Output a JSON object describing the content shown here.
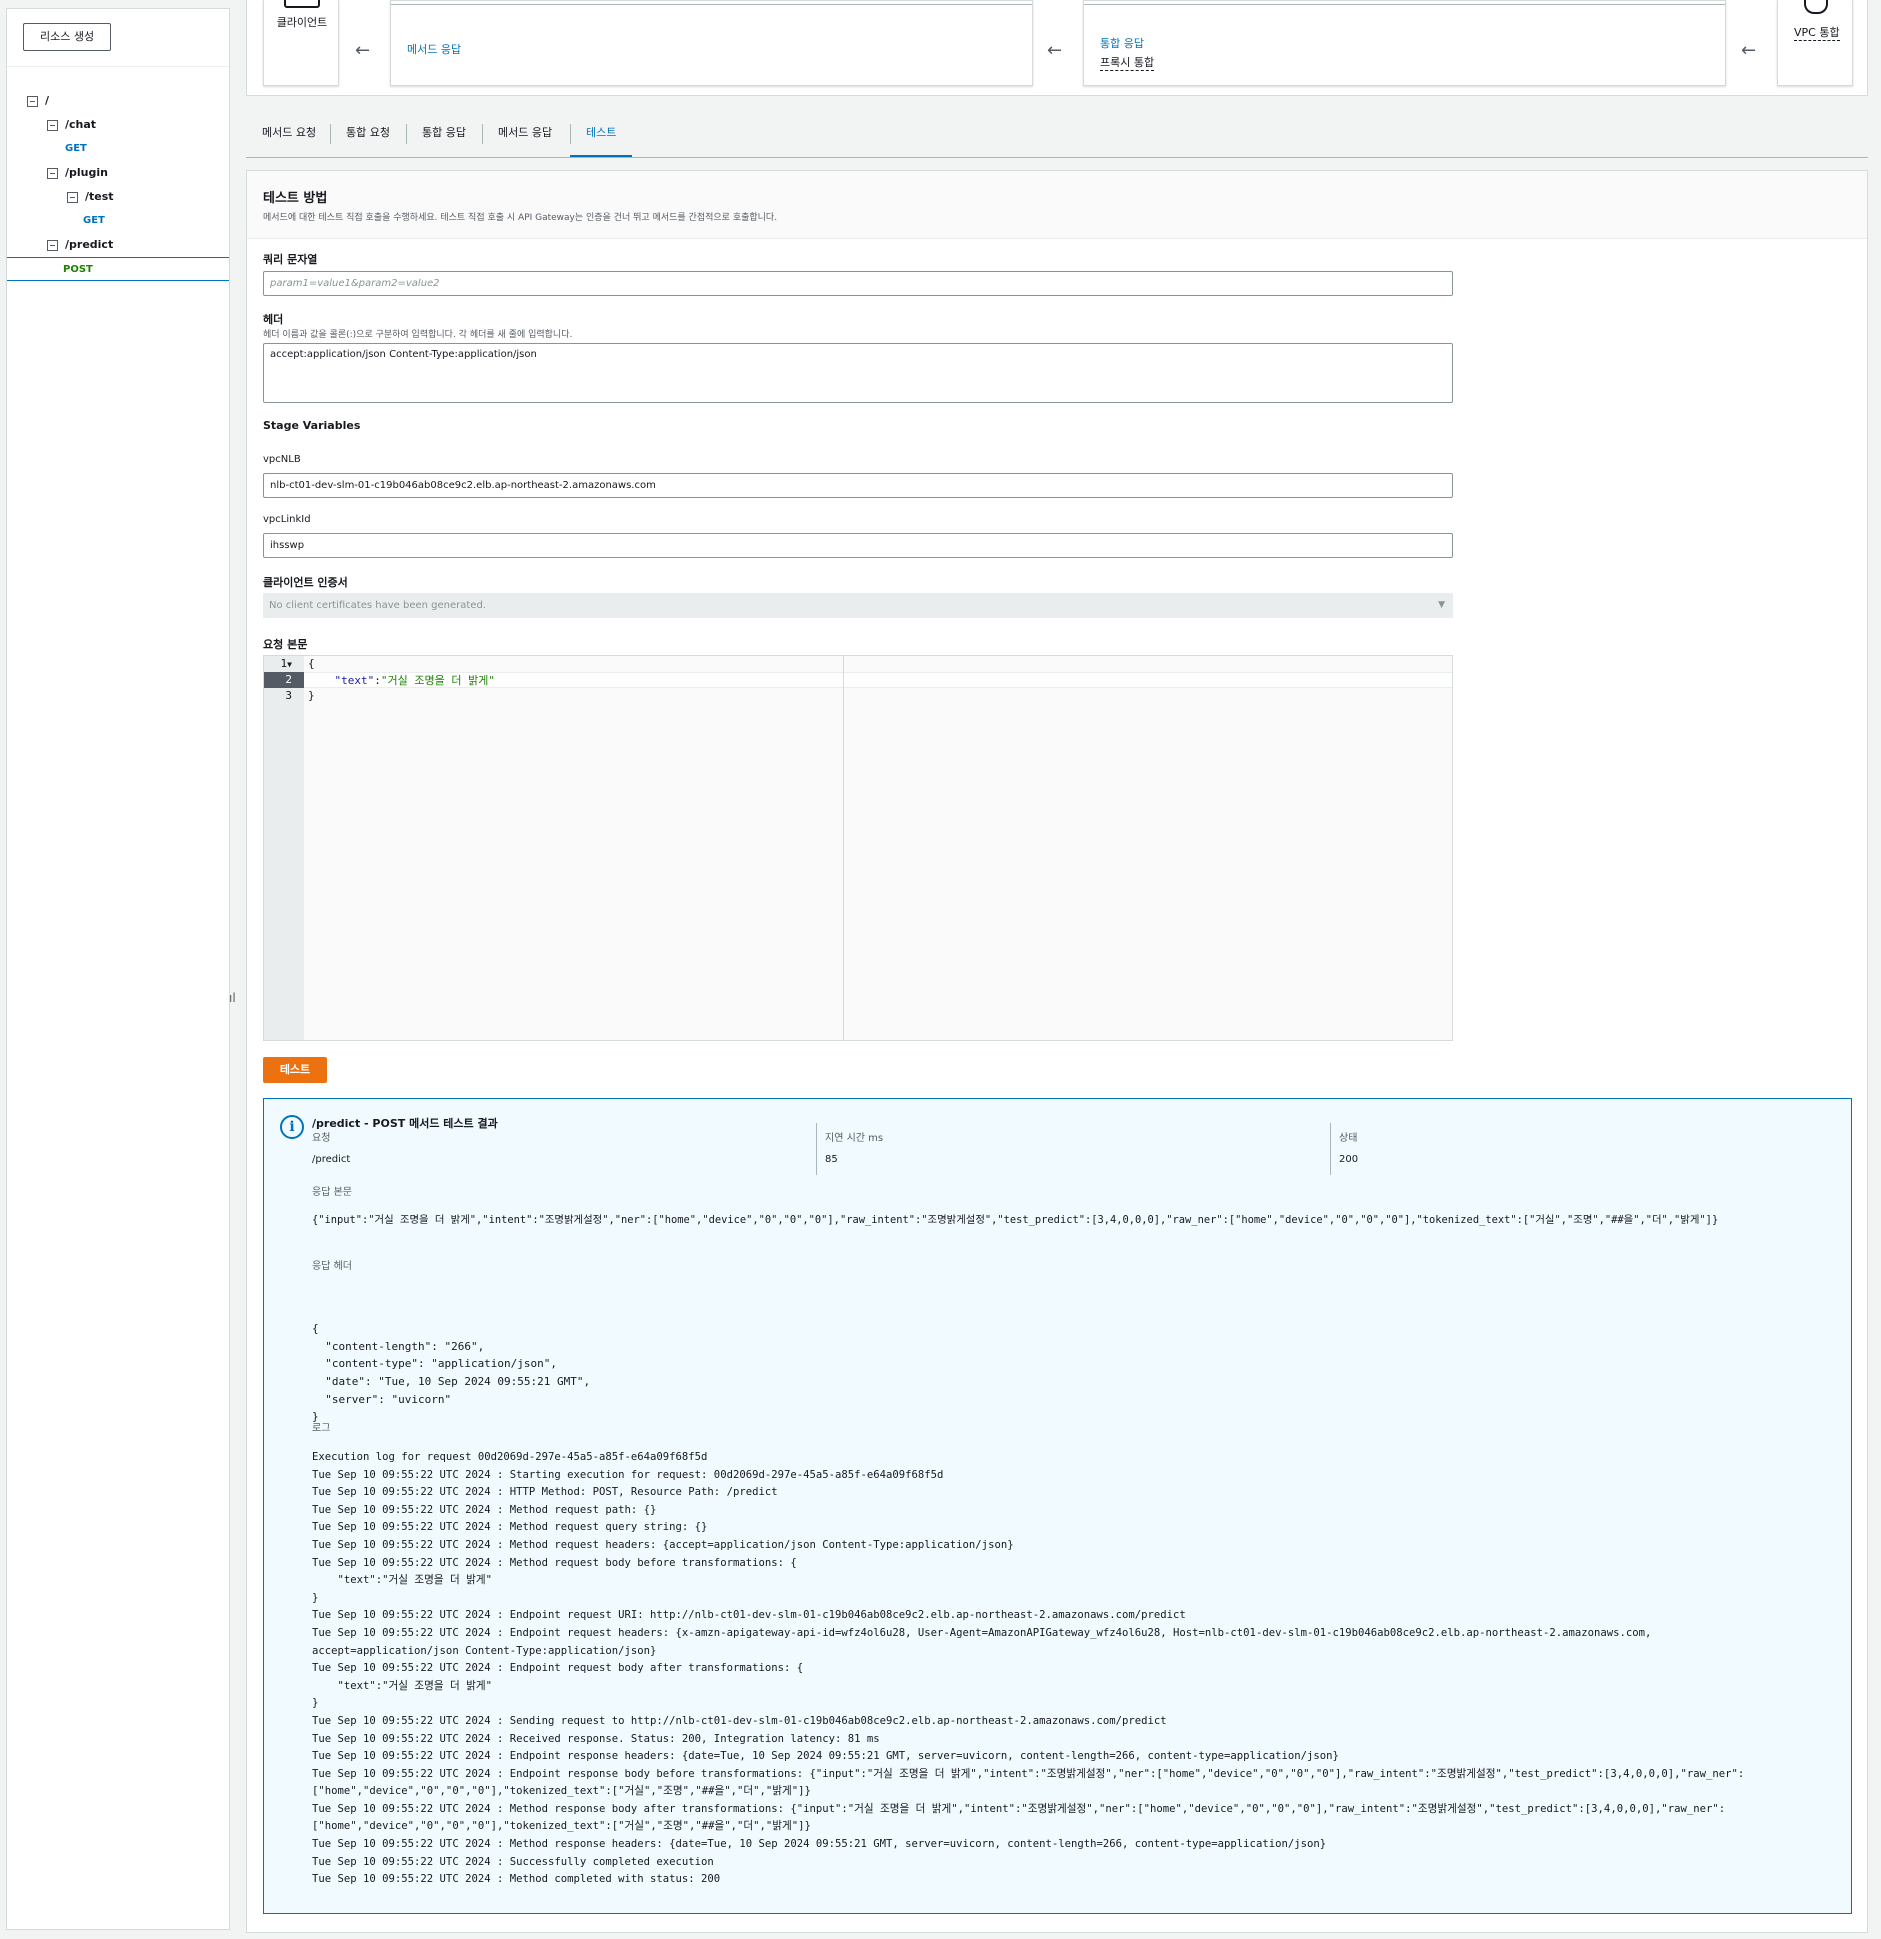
{
  "sidebar": {
    "create_button": "리소스 생성",
    "tree": [
      {
        "label": "/",
        "type": "path",
        "depth": 0
      },
      {
        "label": "/chat",
        "type": "path",
        "depth": 1
      },
      {
        "label": "GET",
        "type": "method",
        "depth": 2
      },
      {
        "label": "/plugin",
        "type": "path",
        "depth": 1
      },
      {
        "label": "/test",
        "type": "path",
        "depth": 2
      },
      {
        "label": "GET",
        "type": "method",
        "depth": 3
      },
      {
        "label": "/predict",
        "type": "path",
        "depth": 1
      },
      {
        "label": "POST",
        "type": "method",
        "depth": 2,
        "selected": true
      }
    ],
    "collapse_glyph": "ıl"
  },
  "flow": {
    "client": "클라이언트",
    "method_response": "메서드 응답",
    "integration_response": "통합 응답",
    "integration_response_sub": "프록시 통합",
    "vpc": "VPC 통합",
    "arrow": "←"
  },
  "tabs": [
    {
      "label": "메서드 요청",
      "active": false
    },
    {
      "label": "통합 요청",
      "active": false
    },
    {
      "label": "통합 응답",
      "active": false
    },
    {
      "label": "메서드 응답",
      "active": false
    },
    {
      "label": "테스트",
      "active": true
    }
  ],
  "test": {
    "title": "테스트 방법",
    "description": "메서드에 대한 테스트 직접 호출을 수행하세요. 테스트 직접 호출 시 API Gateway는 인증을 건너 뛰고 메서드를 간접적으로 호출합니다.",
    "query_label": "쿼리 문자열",
    "query_placeholder": "param1=value1&param2=value2",
    "headers_label": "헤더",
    "headers_hint": "헤더 이름과 값을 콜론(:)으로 구분하여 입력합니다. 각 헤더를 새 줄에 입력합니다.",
    "headers_value": "accept:application/json Content-Type:application/json",
    "stage_vars_label": "Stage Variables",
    "vpcnlb_label": "vpcNLB",
    "vpcnlb_value": "nlb-ct01-dev-slm-01-c19b046ab08ce9c2.elb.ap-northeast-2.amazonaws.com",
    "vpclinkid_label": "vpcLinkId",
    "vpclinkid_value": "ihsswp",
    "client_cert_label": "클라이언트 인증서",
    "client_cert_value": "No client certificates have been generated.",
    "body_label": "요청 본문",
    "body_lines": [
      "1",
      "2",
      "3"
    ],
    "body_open": "{",
    "body_key": "\"text\"",
    "body_colon": ":",
    "body_val": "\"거실 조명을 더 밝게\"",
    "body_close": "}",
    "test_button": "테스트"
  },
  "result": {
    "title": "/predict - POST 메서드 테스트 결과",
    "request_label": "요청",
    "request_value": "/predict",
    "latency_label": "지연 시간 ms",
    "latency_value": "85",
    "status_label": "상태",
    "status_value": "200",
    "response_body_label": "응답 본문",
    "response_body": "{\"input\":\"거실 조명을 더 밝게\",\"intent\":\"조명밝게설정\",\"ner\":[\"home\",\"device\",\"0\",\"0\",\"0\"],\"raw_intent\":\"조명밝게설정\",\"test_predict\":[3,4,0,0,0],\"raw_ner\":[\"home\",\"device\",\"0\",\"0\",\"0\"],\"tokenized_text\":[\"거실\",\"조명\",\"##을\",\"더\",\"밝게\"]}",
    "response_headers_label": "응답 헤더",
    "response_headers": [
      "{",
      "  \"content-length\": \"266\",",
      "  \"content-type\": \"application/json\",",
      "  \"date\": \"Tue, 10 Sep 2024 09:55:21 GMT\",",
      "  \"server\": \"uvicorn\"",
      "}"
    ],
    "logs_label": "로그",
    "logs": [
      "Execution log for request 00d2069d-297e-45a5-a85f-e64a09f68f5d",
      "Tue Sep 10 09:55:22 UTC 2024 : Starting execution for request: 00d2069d-297e-45a5-a85f-e64a09f68f5d",
      "Tue Sep 10 09:55:22 UTC 2024 : HTTP Method: POST, Resource Path: /predict",
      "Tue Sep 10 09:55:22 UTC 2024 : Method request path: {}",
      "Tue Sep 10 09:55:22 UTC 2024 : Method request query string: {}",
      "Tue Sep 10 09:55:22 UTC 2024 : Method request headers: {accept=application/json Content-Type:application/json}",
      "Tue Sep 10 09:55:22 UTC 2024 : Method request body before transformations: {",
      "    \"text\":\"거실 조명을 더 밝게\"",
      "}",
      "Tue Sep 10 09:55:22 UTC 2024 : Endpoint request URI: http://nlb-ct01-dev-slm-01-c19b046ab08ce9c2.elb.ap-northeast-2.amazonaws.com/predict",
      "Tue Sep 10 09:55:22 UTC 2024 : Endpoint request headers: {x-amzn-apigateway-api-id=wfz4ol6u28, User-Agent=AmazonAPIGateway_wfz4ol6u28, Host=nlb-ct01-dev-slm-01-c19b046ab08ce9c2.elb.ap-northeast-2.amazonaws.com,",
      "accept=application/json Content-Type:application/json}",
      "Tue Sep 10 09:55:22 UTC 2024 : Endpoint request body after transformations: {",
      "    \"text\":\"거실 조명을 더 밝게\"",
      "}",
      "Tue Sep 10 09:55:22 UTC 2024 : Sending request to http://nlb-ct01-dev-slm-01-c19b046ab08ce9c2.elb.ap-northeast-2.amazonaws.com/predict",
      "Tue Sep 10 09:55:22 UTC 2024 : Received response. Status: 200, Integration latency: 81 ms",
      "Tue Sep 10 09:55:22 UTC 2024 : Endpoint response headers: {date=Tue, 10 Sep 2024 09:55:21 GMT, server=uvicorn, content-length=266, content-type=application/json}",
      "Tue Sep 10 09:55:22 UTC 2024 : Endpoint response body before transformations: {\"input\":\"거실 조명을 더 밝게\",\"intent\":\"조명밝게설정\",\"ner\":[\"home\",\"device\",\"0\",\"0\",\"0\"],\"raw_intent\":\"조명밝게설정\",\"test_predict\":[3,4,0,0,0],\"raw_ner\":",
      "[\"home\",\"device\",\"0\",\"0\",\"0\"],\"tokenized_text\":[\"거실\",\"조명\",\"##을\",\"더\",\"밝게\"]}",
      "Tue Sep 10 09:55:22 UTC 2024 : Method response body after transformations: {\"input\":\"거실 조명을 더 밝게\",\"intent\":\"조명밝게설정\",\"ner\":[\"home\",\"device\",\"0\",\"0\",\"0\"],\"raw_intent\":\"조명밝게설정\",\"test_predict\":[3,4,0,0,0],\"raw_ner\":",
      "[\"home\",\"device\",\"0\",\"0\",\"0\"],\"tokenized_text\":[\"거실\",\"조명\",\"##을\",\"더\",\"밝게\"]}",
      "Tue Sep 10 09:55:22 UTC 2024 : Method response headers: {date=Tue, 10 Sep 2024 09:55:21 GMT, server=uvicorn, content-length=266, content-type=application/json}",
      "Tue Sep 10 09:55:22 UTC 2024 : Successfully completed execution",
      "Tue Sep 10 09:55:22 UTC 2024 : Method completed with status: 200"
    ]
  },
  "colors": {
    "link": "#0073bb",
    "accent_button": "#ec7211",
    "selected_method": "#1d8102",
    "info_bg": "#f1faff"
  }
}
